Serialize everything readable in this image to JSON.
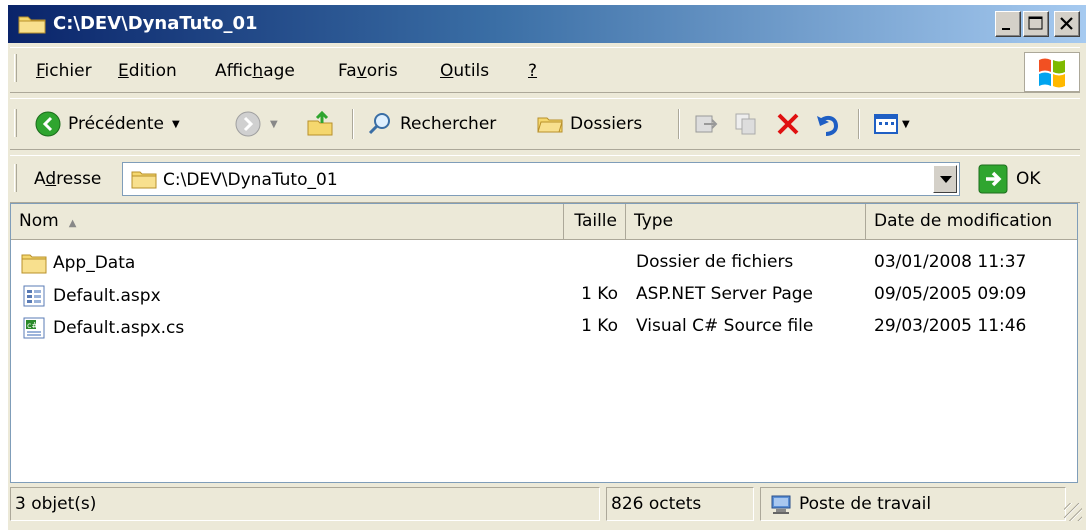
{
  "window": {
    "title": "C:\\DEV\\DynaTuto_01"
  },
  "menu": {
    "items": [
      {
        "label": "Fichier",
        "accel": "F",
        "rest": "ichier"
      },
      {
        "label": "Edition",
        "accel": "E",
        "rest": "dition"
      },
      {
        "label": "Affichage",
        "pre": "Affic",
        "accel": "h",
        "post": "age"
      },
      {
        "label": "Favoris",
        "pre": "Fa",
        "accel": "v",
        "post": "oris"
      },
      {
        "label": "Outils",
        "accel": "O",
        "rest": "utils"
      },
      {
        "label": "?",
        "accel": "?"
      }
    ]
  },
  "toolbar": {
    "back_label": "Précédente",
    "search_label": "Rechercher",
    "folders_label": "Dossiers"
  },
  "address": {
    "label_accel": "d",
    "label_pre": "A",
    "label_post": "resse",
    "value": "C:\\DEV\\DynaTuto_01",
    "go_label": "OK"
  },
  "columns": {
    "name": "Nom",
    "size": "Taille",
    "type": "Type",
    "date": "Date de modification"
  },
  "files": [
    {
      "name": "App_Data",
      "size": "",
      "type": "Dossier de fichiers",
      "date": "03/01/2008 11:37",
      "icon": "folder-icon"
    },
    {
      "name": "Default.aspx",
      "size": "1 Ko",
      "type": "ASP.NET Server Page",
      "date": "09/05/2005 09:09",
      "icon": "aspx-file-icon"
    },
    {
      "name": "Default.aspx.cs",
      "size": "1 Ko",
      "type": "Visual C# Source file",
      "date": "29/03/2005 11:46",
      "icon": "csharp-file-icon"
    }
  ],
  "status": {
    "count": "3 objet(s)",
    "size": "826 octets",
    "zone": "Poste de travail"
  },
  "colors": {
    "title_start": "#0a246a",
    "title_end": "#a6caf0",
    "chrome": "#ece9d8",
    "delete_red": "#e01010",
    "go_green": "#2fa52f"
  }
}
